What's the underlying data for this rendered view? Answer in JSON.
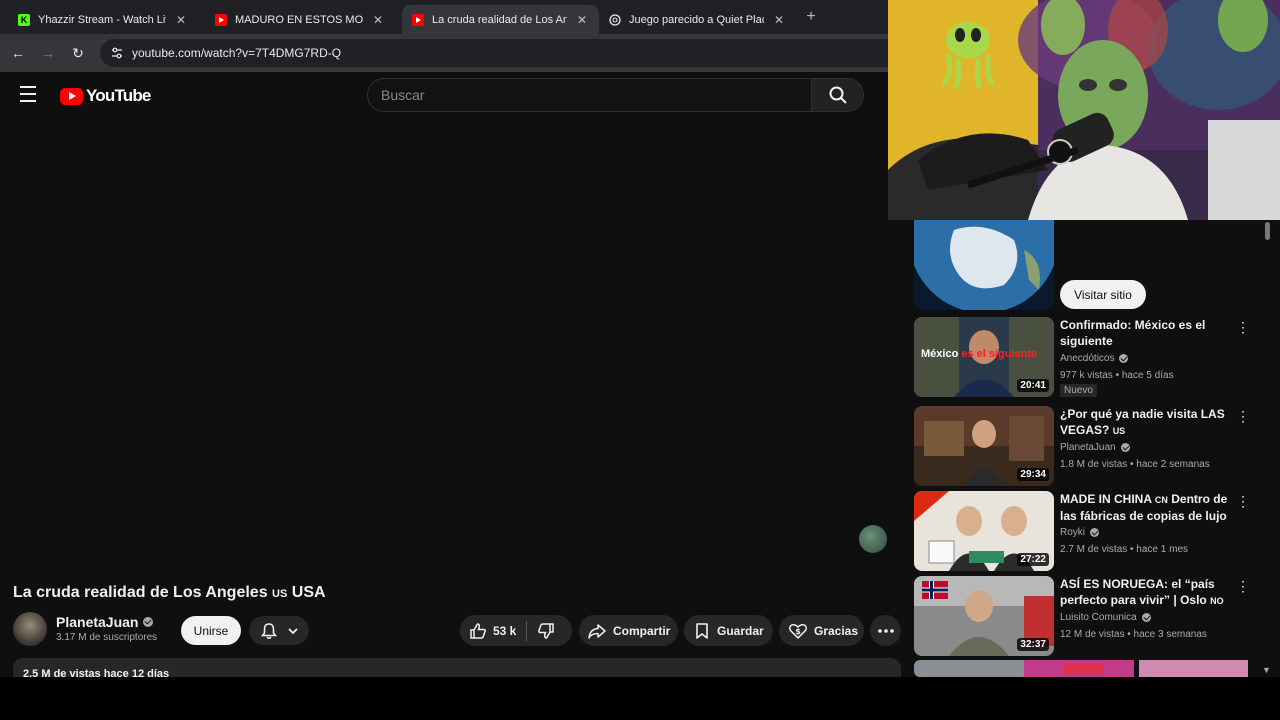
{
  "browser": {
    "tabs": [
      {
        "title": "Yhazzir Stream - Watch Live on",
        "icon": "kick-icon"
      },
      {
        "title": "MADURO EN ESTOS MOMENTOS",
        "icon": "youtube-icon"
      },
      {
        "title": "La cruda realidad de Los Angeles",
        "icon": "youtube-icon"
      },
      {
        "title": "Juego parecido a Quiet Place",
        "icon": "chatgpt-icon"
      }
    ],
    "close_glyph": "✕",
    "new_tab_glyph": "+",
    "url": "youtube.com/watch?v=7T4DMG7RD-Q"
  },
  "youtube": {
    "logo_text": "YouTube",
    "search_placeholder": "Buscar"
  },
  "video": {
    "title_main": "La cruda realidad de Los Angeles",
    "title_flag": "US",
    "title_tail": "USA",
    "channel": "PlanetaJuan",
    "subscribers": "3.17 M de suscriptores",
    "join_label": "Unirse",
    "likes": "53 k",
    "share_label": "Compartir",
    "save_label": "Guardar",
    "thanks_label": "Gracias",
    "description_header": "2.5 M de vistas  hace 12 días"
  },
  "sidebar": {
    "ad_button": "Visitar sitio",
    "recommendations": [
      {
        "title": "Confirmado: México es el siguiente",
        "flag": "",
        "channel": "Anecdóticos",
        "meta": "977 k vistas • hace 5 días",
        "duration": "20:41",
        "badge": "Nuevo",
        "thumb_text_a": "México",
        "thumb_text_b": "es el siguiente"
      },
      {
        "title": "¿Por qué ya nadie visita LAS VEGAS?",
        "flag": "US",
        "channel": "PlanetaJuan",
        "meta": "1.8 M de vistas • hace 2 semanas",
        "duration": "29:34",
        "badge": ""
      },
      {
        "title": "MADE IN CHINA",
        "flag": "CN",
        "title_tail": "Dentro de las fábricas de copias de lujo",
        "channel": "Royki",
        "meta": "2.7 M de vistas • hace 1 mes",
        "duration": "27:22",
        "badge": ""
      },
      {
        "title": "ASÍ ES NORUEGA: el “país perfecto para vivir” | Oslo",
        "flag": "NO",
        "channel": "Luisito Comunica",
        "meta": "12 M de vistas • hace 3 semanas",
        "duration": "32:37",
        "badge": ""
      }
    ]
  },
  "colors": {
    "accent": "#ff0000",
    "bg": "#0f0f0f",
    "chip": "#272727"
  }
}
